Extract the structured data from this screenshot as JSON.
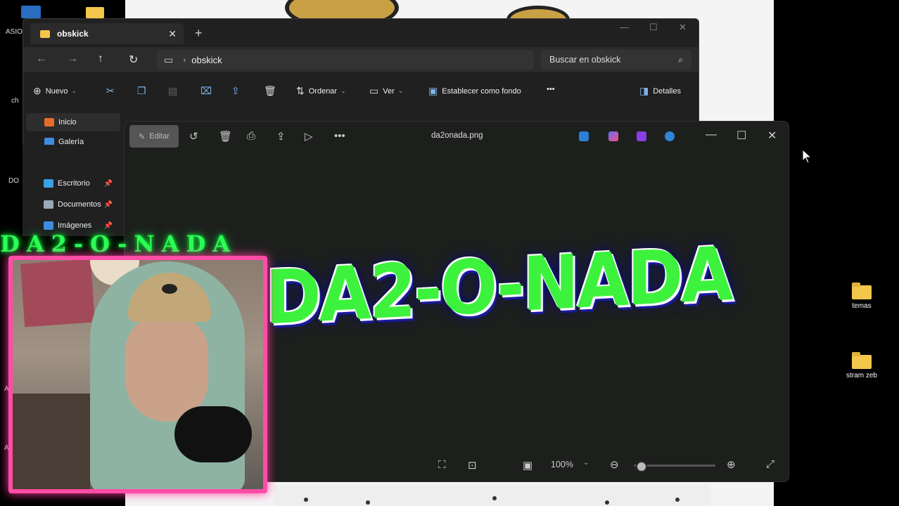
{
  "desktop": {
    "left_labels": [
      "ASIO",
      "ch",
      "DO",
      "A",
      "A"
    ],
    "icons": [
      {
        "label": "temas"
      },
      {
        "label": "stram zeb"
      }
    ]
  },
  "explorer": {
    "tab_label": "obskick",
    "new_tab": "+",
    "address": "obskick",
    "search_placeholder": "Buscar en obskick",
    "commands": {
      "new": "Nuevo",
      "sort": "Ordenar",
      "view": "Ver",
      "set_background": "Establecer como fondo",
      "more": "•••",
      "details": "Detalles"
    },
    "sidebar": [
      {
        "label": "Inicio",
        "color": "#e66a2c"
      },
      {
        "label": "Galería",
        "color": "#3c8de0"
      },
      {
        "label": "Escritorio",
        "color": "#3aa0e8"
      },
      {
        "label": "Documentos",
        "color": "#9aa8b8"
      },
      {
        "label": "Imágenes",
        "color": "#3c8de0"
      }
    ]
  },
  "photos": {
    "edit_label": "Editar",
    "filename": "da2onada.png",
    "zoom": "100%",
    "zoom_slider_fraction": 0.08,
    "image_text": "DA2-O-NADA"
  },
  "overlay": {
    "title": "DA2-O-NADA"
  },
  "colors": {
    "accent_green": "#3cf23c",
    "cam_border": "#ff4da6",
    "folder": "#f3c74c"
  }
}
